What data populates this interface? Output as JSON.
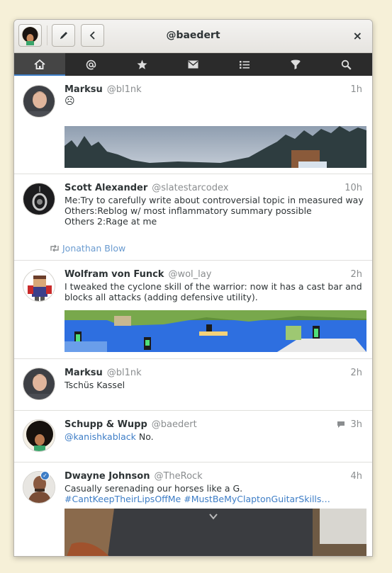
{
  "window": {
    "title": "@baedert",
    "close_label": "×",
    "compose_icon": "pencil-icon",
    "back_icon": "chevron-left-icon"
  },
  "nav": {
    "tabs": [
      {
        "name": "home",
        "icon": "home-icon",
        "active": true
      },
      {
        "name": "mentions",
        "icon": "at-icon",
        "active": false
      },
      {
        "name": "favorites",
        "icon": "star-icon",
        "active": false
      },
      {
        "name": "messages",
        "icon": "envelope-icon",
        "active": false
      },
      {
        "name": "lists",
        "icon": "list-icon",
        "active": false
      },
      {
        "name": "filters",
        "icon": "filter-icon",
        "active": false
      },
      {
        "name": "search",
        "icon": "search-icon",
        "active": false
      }
    ]
  },
  "tweets": [
    {
      "name": "Marksu",
      "handle": "@bl1nk",
      "time": "1h",
      "text": "☹"
    },
    {
      "name": "Scott Alexander",
      "handle": "@slatestarcodex",
      "time": "10h",
      "text": "Me:Try to carefully write about controversial topic in measured way\nOthers:Reblog w/ most inflammatory summary possible\nOthers 2:Rage at me",
      "retweeted_by": "Jonathan Blow"
    },
    {
      "name": "Wolfram von Funck",
      "handle": "@wol_lay",
      "time": "2h",
      "text": "I tweaked the cyclone skill of the warrior: now it has a cast bar and blocks all attacks (adding defensive utility)."
    },
    {
      "name": "Marksu",
      "handle": "@bl1nk",
      "time": "2h",
      "text": "Tschüs Kassel"
    },
    {
      "name": "Schupp & Wupp",
      "handle": "@baedert",
      "time": "3h",
      "mention": "@kanishkablack",
      "text": " No."
    },
    {
      "name": "Dwayne Johnson",
      "handle": "@TheRock",
      "time": "4h",
      "text": "Casually serenading our horses like a G.",
      "hashtags": "#CantKeepTheirLipsOffMe #MustBeMyClaptonGuitarSkills…"
    }
  ]
}
